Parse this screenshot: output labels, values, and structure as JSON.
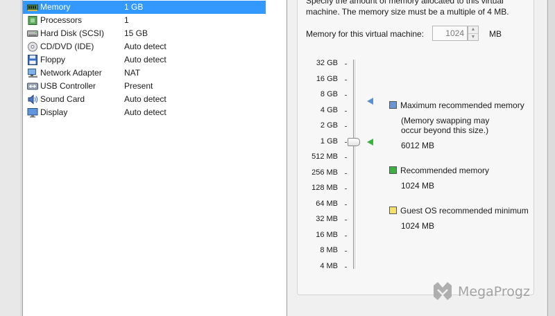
{
  "devices": [
    {
      "name": "Memory",
      "summary": "1 GB",
      "icon": "memory-icon",
      "selected": true
    },
    {
      "name": "Processors",
      "summary": "1",
      "icon": "processor-icon"
    },
    {
      "name": "Hard Disk (SCSI)",
      "summary": "15 GB",
      "icon": "hard-disk-icon"
    },
    {
      "name": "CD/DVD (IDE)",
      "summary": "Auto detect",
      "icon": "cd-dvd-icon"
    },
    {
      "name": "Floppy",
      "summary": "Auto detect",
      "icon": "floppy-icon"
    },
    {
      "name": "Network Adapter",
      "summary": "NAT",
      "icon": "network-adapter-icon"
    },
    {
      "name": "USB Controller",
      "summary": "Present",
      "icon": "usb-icon"
    },
    {
      "name": "Sound Card",
      "summary": "Auto detect",
      "icon": "sound-card-icon"
    },
    {
      "name": "Display",
      "summary": "Auto detect",
      "icon": "display-icon"
    }
  ],
  "memory": {
    "description_line1": "Specify the amount of memory allocated to this virtual",
    "description_line2": "machine. The memory size must be a multiple of 4 MB.",
    "label": "Memory for this virtual machine:",
    "value": "1024",
    "unit": "MB",
    "scale": [
      "32 GB",
      "16 GB",
      "8 GB",
      "4 GB",
      "2 GB",
      "1 GB",
      "512 MB",
      "256 MB",
      "128 MB",
      "64 MB",
      "32 MB",
      "16 MB",
      "8 MB",
      "4 MB"
    ],
    "selected_scale": "1 GB",
    "max_marker_scale": "6 GB",
    "rec_marker_scale": "1 GB"
  },
  "legend": {
    "max_title": "Maximum recommended memory",
    "max_note1": "(Memory swapping may",
    "max_note2": "occur beyond this size.)",
    "max_value": "6012 MB",
    "max_color": "#6a96d4",
    "rec_title": "Recommended memory",
    "rec_value": "1024 MB",
    "rec_color": "#3cb043",
    "min_title": "Guest OS recommended minimum",
    "min_value": "1024 MB",
    "min_color": "#f5e06a"
  },
  "watermark": {
    "text": "MegaProgz",
    "icon": "megaprogz-logo-icon"
  }
}
